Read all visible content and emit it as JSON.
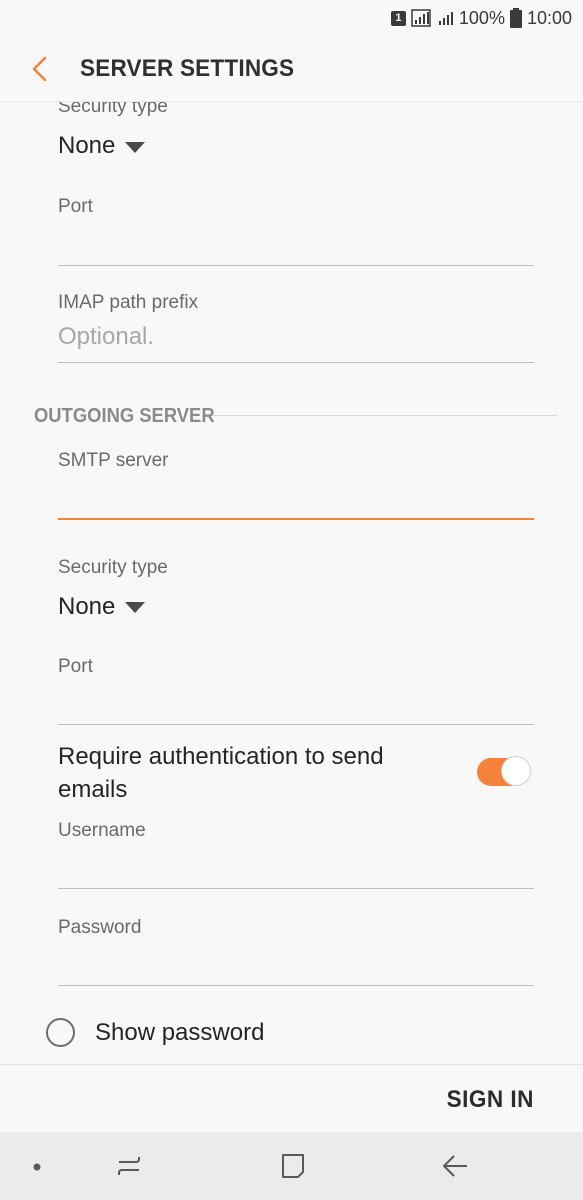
{
  "status_bar": {
    "sim_label": "1",
    "battery_percent": "100%",
    "time": "10:00",
    "icons": [
      "sim-icon",
      "signal-icon",
      "signal-secondary-icon",
      "battery-icon"
    ]
  },
  "header": {
    "title": "SERVER SETTINGS",
    "back_icon": "chevron-left-icon",
    "accent_color": "#f0843c"
  },
  "incoming": {
    "security_type_label": "Security type",
    "security_type_value": "None",
    "port_label": "Port",
    "port_value": "",
    "imap_prefix_label": "IMAP path prefix",
    "imap_prefix_placeholder": "Optional."
  },
  "outgoing": {
    "section_title": "OUTGOING SERVER",
    "smtp_label": "SMTP server",
    "smtp_value": "",
    "security_type_label": "Security type",
    "security_type_value": "None",
    "port_label": "Port",
    "port_value": "",
    "require_auth_label": "Require authentication to send emails",
    "require_auth_enabled": true,
    "username_label": "Username",
    "username_value": "",
    "password_label": "Password",
    "password_value": "",
    "show_password_label": "Show password",
    "show_password_checked": false
  },
  "footer": {
    "sign_in_label": "SIGN IN"
  },
  "nav_bar": {
    "icons": [
      "dot-icon",
      "recents-icon",
      "home-icon",
      "back-icon"
    ]
  }
}
